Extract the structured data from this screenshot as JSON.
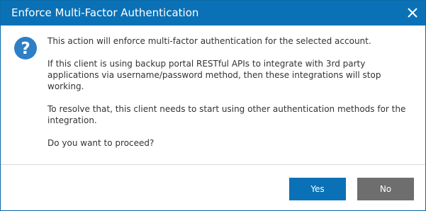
{
  "dialog": {
    "title": "Enforce Multi-Factor Authentication",
    "icons": {
      "close": "close-icon",
      "question": "question-icon"
    },
    "message": {
      "line1": "This action will enforce multi-factor authentication for the selected account.",
      "line2": "If this client is using backup portal RESTful APIs to integrate with 3rd party applications via username/password method, then these integrations will stop working.",
      "line3": "To resolve that, this client needs to start using other authentication methods for the integration.",
      "line4": "Do you want to proceed?"
    },
    "buttons": {
      "yes_label": "Yes",
      "no_label": "No"
    },
    "colors": {
      "titlebar": "#0b71b6",
      "question_icon": "#2d80c6",
      "yes_button": "#0b71b6",
      "no_button": "#6e6e6e"
    }
  }
}
